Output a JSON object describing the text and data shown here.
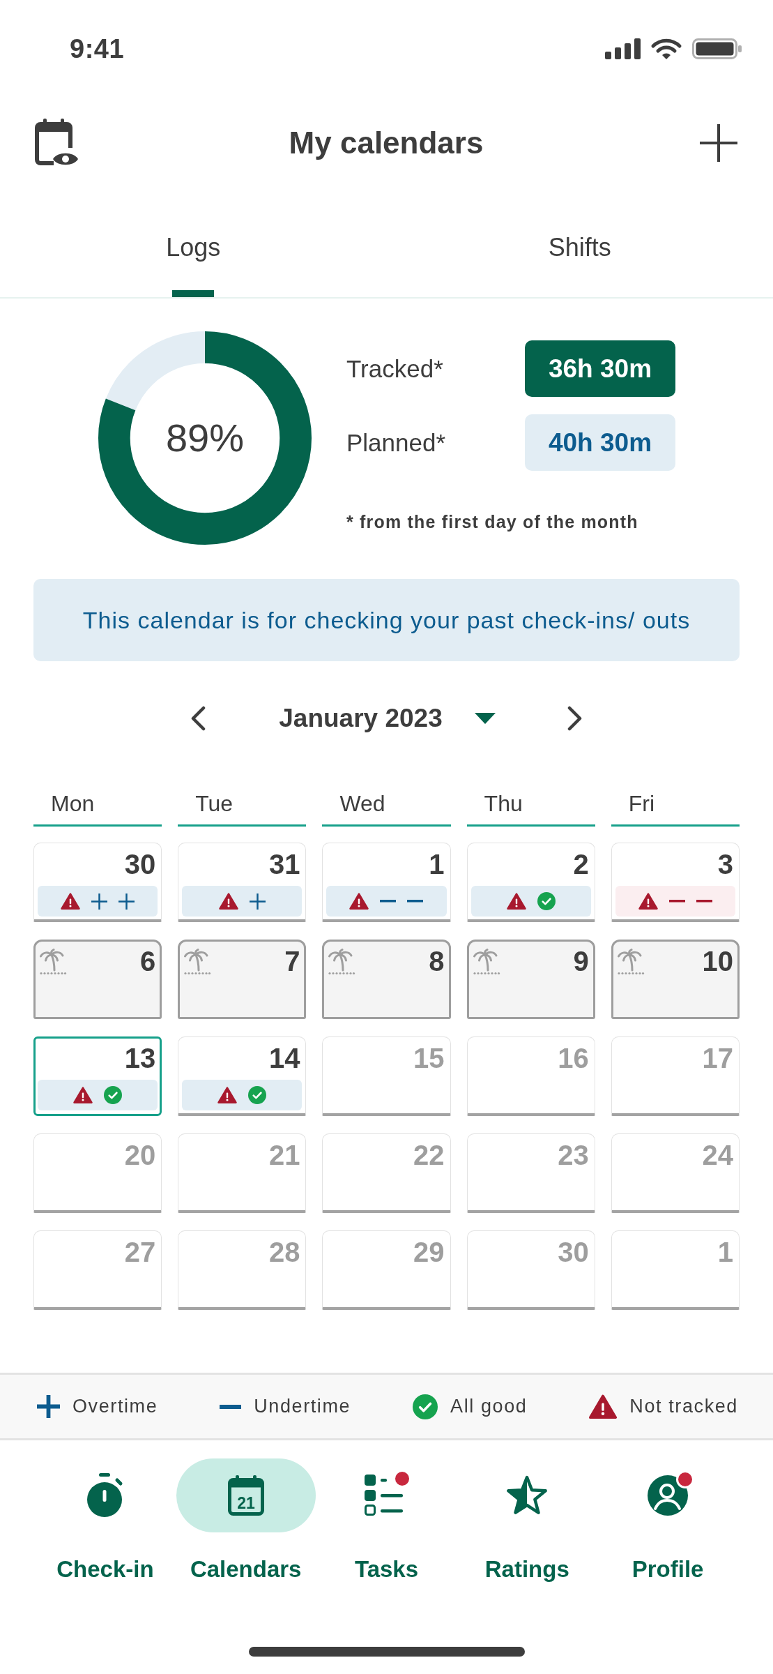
{
  "status_bar": {
    "time": "9:41"
  },
  "header": {
    "title": "My calendars"
  },
  "tabs": [
    {
      "label": "Logs",
      "selected": true
    },
    {
      "label": "Shifts",
      "selected": false
    }
  ],
  "summary": {
    "level": 0.81,
    "reading": "89%",
    "stats": [
      {
        "kind": "tracked",
        "label": "Tracked*",
        "value": "36h 30m"
      },
      {
        "kind": "planned",
        "label": "Planned*",
        "value": "40h 30m"
      }
    ],
    "footnote": "* from the first day of the month"
  },
  "info_banner": "This calendar is for checking your past check-ins/ outs",
  "calendar": {
    "month": "January 2023",
    "weekdays": [
      "Mon",
      "Tue",
      "Wed",
      "Thu",
      "Fri"
    ],
    "days": [
      {
        "day": "30",
        "kind": "past",
        "selected": false,
        "status": {
          "alert": false,
          "marks": [
            {
              "kind": "warning"
            },
            {
              "kind": "plus"
            },
            {
              "kind": "plus"
            }
          ]
        }
      },
      {
        "day": "31",
        "kind": "past",
        "selected": false,
        "status": {
          "alert": false,
          "marks": [
            {
              "kind": "warning"
            },
            {
              "kind": "plus"
            }
          ]
        }
      },
      {
        "day": "1",
        "kind": "past",
        "selected": false,
        "status": {
          "alert": false,
          "marks": [
            {
              "kind": "warning"
            },
            {
              "kind": "minus"
            },
            {
              "kind": "minus"
            }
          ]
        }
      },
      {
        "day": "2",
        "kind": "past",
        "selected": false,
        "status": {
          "alert": false,
          "marks": [
            {
              "kind": "warning"
            },
            {
              "kind": "check"
            }
          ]
        }
      },
      {
        "day": "3",
        "kind": "past",
        "selected": false,
        "status": {
          "alert": true,
          "marks": [
            {
              "kind": "warning"
            },
            {
              "kind": "minus"
            },
            {
              "kind": "minus"
            }
          ]
        }
      },
      {
        "day": "6",
        "kind": "holiday",
        "selected": false
      },
      {
        "day": "7",
        "kind": "holiday",
        "selected": false
      },
      {
        "day": "8",
        "kind": "holiday",
        "selected": false
      },
      {
        "day": "9",
        "kind": "holiday",
        "selected": false
      },
      {
        "day": "10",
        "kind": "holiday",
        "selected": false
      },
      {
        "day": "13",
        "kind": "past",
        "selected": true,
        "status": {
          "alert": false,
          "marks": [
            {
              "kind": "warning"
            },
            {
              "kind": "check"
            }
          ]
        }
      },
      {
        "day": "14",
        "kind": "past",
        "selected": false,
        "status": {
          "alert": false,
          "marks": [
            {
              "kind": "warning"
            },
            {
              "kind": "check"
            }
          ]
        }
      },
      {
        "day": "15",
        "kind": "future",
        "selected": false
      },
      {
        "day": "16",
        "kind": "future",
        "selected": false
      },
      {
        "day": "17",
        "kind": "future",
        "selected": false
      },
      {
        "day": "20",
        "kind": "future",
        "selected": false
      },
      {
        "day": "21",
        "kind": "future",
        "selected": false
      },
      {
        "day": "22",
        "kind": "future",
        "selected": false
      },
      {
        "day": "23",
        "kind": "future",
        "selected": false
      },
      {
        "day": "24",
        "kind": "future",
        "selected": false
      },
      {
        "day": "27",
        "kind": "future",
        "selected": false
      },
      {
        "day": "28",
        "kind": "future",
        "selected": false
      },
      {
        "day": "29",
        "kind": "future",
        "selected": false
      },
      {
        "day": "30",
        "kind": "future",
        "selected": false
      },
      {
        "day": "1",
        "kind": "future",
        "selected": false
      }
    ]
  },
  "legend": [
    {
      "kind": "plus",
      "label": "Overtime"
    },
    {
      "kind": "minus",
      "label": "Undertime"
    },
    {
      "kind": "check",
      "label": "All good"
    },
    {
      "kind": "warning",
      "label": "Not tracked"
    }
  ],
  "nav": [
    {
      "label": "Check-in",
      "kind": "stopwatch",
      "selected": false,
      "badge": false
    },
    {
      "label": "Calendars",
      "kind": "calendar",
      "icon_text": "21",
      "selected": true,
      "badge": false
    },
    {
      "label": "Tasks",
      "kind": "tasks",
      "selected": false,
      "badge": true
    },
    {
      "label": "Ratings",
      "kind": "star",
      "selected": false,
      "badge": false
    },
    {
      "label": "Profile",
      "kind": "profile",
      "selected": false,
      "badge": true
    }
  ]
}
